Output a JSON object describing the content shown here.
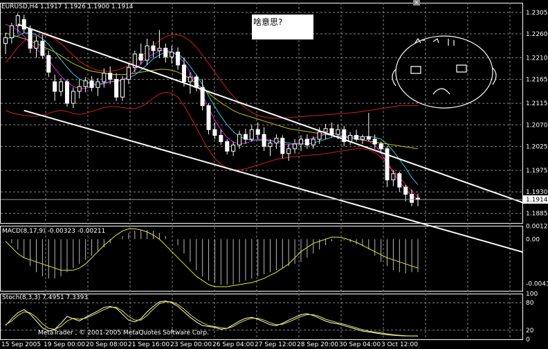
{
  "symbol_header": "EURUSD,H4  1.1917 1.1926 1.1900 1.1914",
  "note": "啥意思?",
  "copyright": "MetaTrader , © 2001-2005 MetaQuotes Software Corp.",
  "colors": {
    "background": "#000000",
    "grid": "#888888",
    "bull_candle": "#ffffff",
    "bear_candle": "#ffffff",
    "ma_red": "#cc1f1f",
    "ma_magenta": "#e020e0",
    "ma_cyan": "#33c6e8",
    "ma_yellow": "#c8c800",
    "channel": "#ffffff",
    "macd_hist": "#bbbbbb",
    "signal": "#e8e830"
  },
  "chart_data": [
    {
      "type": "candlestick",
      "title": "EURUSD,H4",
      "ohlc_readout": {
        "open": 1.1917,
        "high": 1.1926,
        "low": 1.19,
        "close": 1.1914
      },
      "ylim": [
        1.1865,
        1.2325
      ],
      "y_ticks": [
        "1.2305",
        "1.2260",
        "1.2210",
        "1.2165",
        "1.2115",
        "1.2070",
        "1.2025",
        "1.1975",
        "1.1930",
        "1.1885"
      ],
      "current_price_label": "1.1914",
      "x_ticks": [
        "15 Sep 2005",
        "19 Sep 00:00",
        "20 Sep 08:00",
        "21 Sep 16:00",
        "23 Sep 00:00",
        "26 Sep 04:00",
        "27 Sep 12:00",
        "28 Sep 20:00",
        "30 Sep 04:00",
        "3 Oct 12:00"
      ],
      "candles": [
        [
          1.224,
          1.2262,
          1.2218,
          1.2252
        ],
        [
          1.2252,
          1.2283,
          1.224,
          1.2277
        ],
        [
          1.2277,
          1.2303,
          1.2262,
          1.2298
        ],
        [
          1.229,
          1.23,
          1.2262,
          1.227
        ],
        [
          1.227,
          1.2278,
          1.222,
          1.223
        ],
        [
          1.223,
          1.2255,
          1.221,
          1.2245
        ],
        [
          1.2245,
          1.2258,
          1.2208,
          1.2215
        ],
        [
          1.2215,
          1.2225,
          1.217,
          1.218
        ],
        [
          1.216,
          1.2175,
          1.212,
          1.214
        ],
        [
          1.214,
          1.2168,
          1.213,
          1.216
        ],
        [
          1.216,
          1.2165,
          1.2108,
          1.2115
        ],
        [
          1.2115,
          1.2148,
          1.2105,
          1.214
        ],
        [
          1.214,
          1.2165,
          1.2125,
          1.215
        ],
        [
          1.215,
          1.217,
          1.2138,
          1.2162
        ],
        [
          1.2162,
          1.2172,
          1.214,
          1.2148
        ],
        [
          1.2148,
          1.2168,
          1.213,
          1.216
        ],
        [
          1.216,
          1.2188,
          1.2148,
          1.2178
        ],
        [
          1.2178,
          1.2192,
          1.2155,
          1.2165
        ],
        [
          1.2165,
          1.2178,
          1.212,
          1.2128
        ],
        [
          1.2128,
          1.2172,
          1.212,
          1.2165
        ],
        [
          1.2165,
          1.2198,
          1.2155,
          1.219
        ],
        [
          1.219,
          1.2225,
          1.218,
          1.2218
        ],
        [
          1.2218,
          1.224,
          1.2196,
          1.2205
        ],
        [
          1.2205,
          1.225,
          1.2195,
          1.2235
        ],
        [
          1.2235,
          1.2245,
          1.221,
          1.2225
        ],
        [
          1.2225,
          1.2268,
          1.221,
          1.223
        ],
        [
          1.223,
          1.224,
          1.22,
          1.2212
        ],
        [
          1.2212,
          1.2235,
          1.2198,
          1.2222
        ],
        [
          1.2222,
          1.2232,
          1.2185,
          1.2195
        ],
        [
          1.2195,
          1.221,
          1.215,
          1.216
        ],
        [
          1.216,
          1.218,
          1.2135,
          1.217
        ],
        [
          1.217,
          1.2175,
          1.214,
          1.2148
        ],
        [
          1.2148,
          1.2165,
          1.21,
          1.211
        ],
        [
          1.211,
          1.2115,
          1.205,
          1.206
        ],
        [
          1.206,
          1.2075,
          1.204,
          1.2048
        ],
        [
          1.2048,
          1.206,
          1.2028,
          1.2035
        ],
        [
          1.2035,
          1.204,
          1.2008,
          1.2015
        ],
        [
          1.2015,
          1.2035,
          1.2005,
          1.2028
        ],
        [
          1.2028,
          1.2058,
          1.202,
          1.205
        ],
        [
          1.205,
          1.2062,
          1.203,
          1.204
        ],
        [
          1.204,
          1.207,
          1.2035,
          1.206
        ],
        [
          1.206,
          1.2075,
          1.204,
          1.205
        ],
        [
          1.205,
          1.2065,
          1.2015,
          1.2025
        ],
        [
          1.2025,
          1.204,
          1.2005,
          1.2032
        ],
        [
          1.2032,
          1.205,
          1.202,
          1.2042
        ],
        [
          1.2042,
          1.2048,
          1.2,
          1.201
        ],
        [
          1.201,
          1.203,
          1.1995,
          1.202
        ],
        [
          1.202,
          1.204,
          1.201,
          1.203
        ],
        [
          1.203,
          1.2048,
          1.2015,
          1.204
        ],
        [
          1.204,
          1.205,
          1.202,
          1.2028
        ],
        [
          1.2028,
          1.2046,
          1.202,
          1.204
        ],
        [
          1.204,
          1.2065,
          1.203,
          1.2055
        ],
        [
          1.2055,
          1.2072,
          1.204,
          1.2062
        ],
        [
          1.2062,
          1.2075,
          1.2045,
          1.205
        ],
        [
          1.205,
          1.207,
          1.204,
          1.206
        ],
        [
          1.206,
          1.2068,
          1.2025,
          1.2035
        ],
        [
          1.2035,
          1.2055,
          1.2028,
          1.2048
        ],
        [
          1.2048,
          1.206,
          1.2035,
          1.204
        ],
        [
          1.204,
          1.205,
          1.203,
          1.2045
        ],
        [
          1.2045,
          1.2095,
          1.2035,
          1.204
        ],
        [
          1.204,
          1.205,
          1.202,
          1.203
        ],
        [
          1.203,
          1.2035,
          1.201,
          1.202
        ],
        [
          1.202,
          1.2025,
          1.194,
          1.1955
        ],
        [
          1.1955,
          1.1975,
          1.1942,
          1.1968
        ],
        [
          1.1968,
          1.1972,
          1.193,
          1.194
        ],
        [
          1.194,
          1.1945,
          1.191,
          1.1925
        ],
        [
          1.1925,
          1.1935,
          1.19,
          1.1908
        ],
        [
          1.1917,
          1.1926,
          1.19,
          1.1914
        ]
      ],
      "ma_red": [
        1.22,
        1.2215,
        1.2232,
        1.2245,
        1.2252,
        1.2256,
        1.2258,
        1.2256,
        1.225,
        1.224,
        1.2228,
        1.2215,
        1.2203,
        1.2195,
        1.2188,
        1.2184,
        1.2182,
        1.2182,
        1.2184,
        1.2188,
        1.2194,
        1.2202,
        1.2212,
        1.2224,
        1.2236,
        1.2246,
        1.2254,
        1.2258,
        1.2258,
        1.2254,
        1.2245,
        1.2232,
        1.2216,
        1.2198,
        1.218,
        1.2162,
        1.2145,
        1.213,
        1.2116,
        1.2105,
        1.2096,
        1.209,
        1.2086,
        1.2084,
        1.2084,
        1.2084,
        1.2085,
        1.2086,
        1.2087,
        1.2088,
        1.2089,
        1.209,
        1.2091,
        1.2092,
        1.2093,
        1.2094,
        1.2095,
        1.2096,
        1.2098,
        1.21,
        1.2102,
        1.2104,
        1.2106,
        1.2108,
        1.211,
        1.211,
        1.211,
        1.211
      ],
      "ma_red_lower": [
        1.21,
        1.2095,
        1.2092,
        1.209,
        1.2088,
        1.2088,
        1.209,
        1.2094,
        1.2098,
        1.21,
        1.2098,
        1.2094,
        1.2092,
        1.2094,
        1.2098,
        1.2102,
        1.2106,
        1.2108,
        1.2108,
        1.2106,
        1.2104,
        1.2104,
        1.2108,
        1.2116,
        1.2126,
        1.2134,
        1.2138,
        1.2136,
        1.2128,
        1.211,
        1.2088,
        1.2064,
        1.204,
        1.2018,
        1.2,
        1.1988,
        1.198,
        1.1976,
        1.1976,
        1.1978,
        1.1982,
        1.1986,
        1.199,
        1.1994,
        1.1998,
        1.2,
        1.2002,
        1.2004,
        1.2005,
        1.2006,
        1.2007,
        1.2008,
        1.201,
        1.2012,
        1.2014,
        1.2016,
        1.2018,
        1.202,
        1.202,
        1.2018,
        1.2012,
        1.2002,
        1.199,
        1.1975,
        1.196,
        1.1945,
        1.1932,
        1.192
      ],
      "ma_cyan": [
        1.225,
        1.2252,
        1.2256,
        1.2262,
        1.2262,
        1.2258,
        1.225,
        1.2238,
        1.2222,
        1.2206,
        1.219,
        1.2176,
        1.2166,
        1.216,
        1.2156,
        1.2154,
        1.2156,
        1.216,
        1.2162,
        1.2164,
        1.2168,
        1.2174,
        1.2184,
        1.2196,
        1.2208,
        1.2216,
        1.2222,
        1.2222,
        1.2218,
        1.2208,
        1.2192,
        1.2174,
        1.2154,
        1.213,
        1.2108,
        1.2088,
        1.207,
        1.2056,
        1.2046,
        1.204,
        1.2038,
        1.2038,
        1.2038,
        1.2036,
        1.2036,
        1.2034,
        1.2032,
        1.203,
        1.203,
        1.203,
        1.2032,
        1.2036,
        1.204,
        1.2044,
        1.2046,
        1.2046,
        1.2046,
        1.2045,
        1.2045,
        1.2046,
        1.2044,
        1.204,
        1.203,
        1.2015,
        1.1998,
        1.198,
        1.196,
        1.1945
      ],
      "ma_magenta": [
        1.228,
        1.2275,
        1.2268,
        1.2255,
        1.224,
        1.2228,
        1.2218,
        1.2205,
        1.2188,
        1.2172,
        1.216,
        1.215,
        1.2146,
        1.2146,
        1.215,
        1.2154,
        1.2158,
        1.216,
        1.216,
        1.2164,
        1.2172,
        1.2184,
        1.2198,
        1.221,
        1.2218,
        1.2224,
        1.2226,
        1.2222,
        1.2214,
        1.22,
        1.218,
        1.2158,
        1.2132,
        1.2105,
        1.208,
        1.206,
        1.2044,
        1.2034,
        1.203,
        1.2032,
        1.2036,
        1.204,
        1.204,
        1.2038,
        1.2034,
        1.203,
        1.2028,
        1.203,
        1.2034,
        1.2038,
        1.2042,
        1.2046,
        1.205,
        1.2052,
        1.205,
        1.2046,
        1.2044,
        1.2042,
        1.204,
        1.2036,
        1.2028,
        1.2012,
        1.199,
        1.197,
        1.1952,
        1.1935,
        1.1922,
        1.1915
      ],
      "ma_yellow": [
        1.2262,
        1.2258,
        1.2254,
        1.225,
        1.2245,
        1.224,
        1.2234,
        1.2228,
        1.2222,
        1.2214,
        1.2206,
        1.2198,
        1.2192,
        1.2186,
        1.2182,
        1.218,
        1.2178,
        1.2176,
        1.2175,
        1.2175,
        1.2176,
        1.2178,
        1.218,
        1.2182,
        1.2184,
        1.2186,
        1.2186,
        1.2184,
        1.218,
        1.2174,
        1.2166,
        1.2156,
        1.2146,
        1.2136,
        1.2126,
        1.2116,
        1.2108,
        1.21,
        1.2094,
        1.209,
        1.2086,
        1.2082,
        1.2078,
        1.2074,
        1.207,
        1.2066,
        1.2062,
        1.206,
        1.2058,
        1.2056,
        1.2054,
        1.2052,
        1.205,
        1.2048,
        1.2046,
        1.2044,
        1.2042,
        1.204,
        1.2038,
        1.2036,
        1.2034,
        1.2032,
        1.203,
        1.2028,
        1.2026,
        1.2024,
        1.2022,
        1.202
      ],
      "channel_upper": [
        [
          2,
          1.228
        ],
        [
          67,
          1.1985
        ]
      ],
      "channel_lower": [
        [
          3,
          1.21
        ],
        [
          66,
          1.187
        ]
      ]
    },
    {
      "type": "bar",
      "title": "MACD(8,17,9) -0.00323 -0.00211",
      "ylim": [
        -0.005,
        0.0013
      ],
      "y_ticks": [
        "0.00125",
        "0.00",
        "-0.00430"
      ],
      "values": [
        0.0,
        -0.0004,
        -0.001,
        -0.0018,
        -0.0026,
        -0.0032,
        -0.0036,
        -0.0038,
        -0.0038,
        -0.0036,
        -0.0032,
        -0.0028,
        -0.0024,
        -0.002,
        -0.0016,
        -0.0012,
        -0.0008,
        -0.0004,
        0.0,
        0.0003,
        0.0006,
        0.0008,
        0.0009,
        0.0009,
        0.0008,
        0.0006,
        0.0003,
        0.0,
        -0.0006,
        -0.0014,
        -0.0022,
        -0.003,
        -0.0036,
        -0.004,
        -0.0042,
        -0.0044,
        -0.0044,
        -0.0044,
        -0.0042,
        -0.004,
        -0.0038,
        -0.0036,
        -0.0034,
        -0.0032,
        -0.003,
        -0.0028,
        -0.0026,
        -0.0024,
        -0.0022,
        -0.0018,
        -0.0014,
        -0.001,
        -0.0006,
        -0.0002,
        0.0,
        -0.0001,
        -0.0003,
        -0.0005,
        -0.0007,
        -0.001,
        -0.0016,
        -0.0022,
        -0.0026,
        -0.003,
        -0.0032,
        -0.0033,
        -0.0032,
        -0.0032
      ],
      "signal": [
        -0.0002,
        -0.0008,
        -0.0014,
        -0.0018,
        -0.002,
        -0.0022,
        -0.0024,
        -0.0026,
        -0.0028,
        -0.003,
        -0.003,
        -0.003,
        -0.0028,
        -0.0024,
        -0.0018,
        -0.0012,
        -0.0006,
        -0.0001,
        0.0004,
        0.0008,
        0.001,
        0.001,
        0.0009,
        0.0007,
        0.0004,
        0.0,
        -0.0006,
        -0.0012,
        -0.0018,
        -0.0024,
        -0.003,
        -0.0036,
        -0.004,
        -0.0044,
        -0.0046,
        -0.0046,
        -0.0046,
        -0.0045,
        -0.0044,
        -0.0043,
        -0.0042,
        -0.004,
        -0.0038,
        -0.0035,
        -0.0032,
        -0.0028,
        -0.0024,
        -0.0018,
        -0.0012,
        -0.0008,
        -0.0004,
        -0.0002,
        0.0,
        0.0002,
        0.0002,
        0.0001,
        -0.0001,
        -0.0003,
        -0.0006,
        -0.0009,
        -0.0012,
        -0.0015,
        -0.0018,
        -0.002,
        -0.0022,
        -0.0024,
        -0.0026,
        -0.0028
      ]
    },
    {
      "type": "line",
      "title": "Stoch(8,3,3) 7.4951 7.3393",
      "ylim": [
        0,
        100
      ],
      "y_ticks": [
        "100",
        "80",
        "20",
        "0"
      ],
      "series": [
        {
          "color": "#ffffff",
          "values": [
            30,
            45,
            58,
            65,
            55,
            40,
            25,
            18,
            22,
            35,
            50,
            45,
            40,
            48,
            55,
            62,
            70,
            72,
            68,
            55,
            42,
            38,
            45,
            60,
            72,
            82,
            84,
            80,
            72,
            60,
            48,
            38,
            30,
            28,
            26,
            22,
            24,
            32,
            40,
            46,
            48,
            44,
            38,
            32,
            30,
            35,
            42,
            48,
            54,
            56,
            52,
            46,
            40,
            36,
            34,
            30,
            26,
            22,
            18,
            16,
            14,
            12,
            10,
            9,
            8,
            7.5,
            7.5,
            7.5
          ]
        },
        {
          "color": "#e8e830",
          "values": [
            32,
            40,
            52,
            60,
            58,
            48,
            34,
            24,
            22,
            28,
            40,
            46,
            44,
            46,
            52,
            58,
            65,
            70,
            70,
            62,
            50,
            42,
            42,
            52,
            66,
            78,
            82,
            82,
            76,
            66,
            54,
            44,
            36,
            30,
            28,
            25,
            24,
            28,
            36,
            42,
            46,
            46,
            42,
            36,
            32,
            33,
            38,
            44,
            50,
            54,
            54,
            50,
            44,
            40,
            36,
            33,
            29,
            25,
            21,
            18,
            16,
            14,
            12,
            10,
            9,
            8,
            7.4,
            7.3
          ]
        }
      ]
    }
  ]
}
